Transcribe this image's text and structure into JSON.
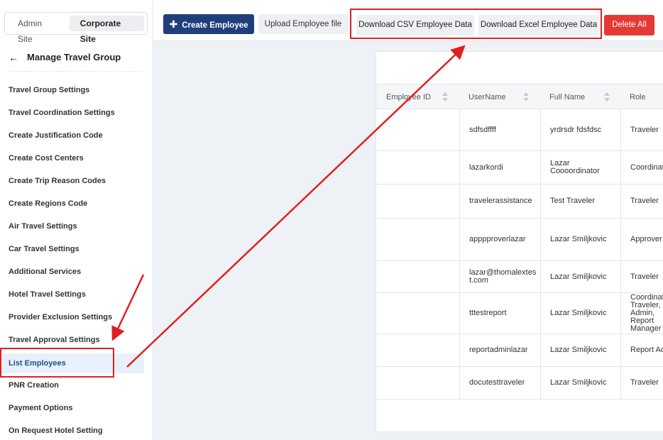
{
  "site_switch": {
    "admin": "Admin Site",
    "corporate": "Corporate Site"
  },
  "sidebar": {
    "title": "Manage Travel Group",
    "items": [
      "Travel Group Settings",
      "Travel Coordination Settings",
      "Create Justification Code",
      "Create Cost Centers",
      "Create Trip Reason Codes",
      "Create Regions Code",
      "Air Travel Settings",
      "Car Travel Settings",
      "Additional Services",
      "Hotel Travel Settings",
      "Provider Exclusion Settings",
      "Travel Approval Settings",
      "List Employees",
      "PNR Creation",
      "Payment Options",
      "On Request Hotel Setting"
    ],
    "active_index": 12
  },
  "toolbar": {
    "create": "Create Employee",
    "upload": "Upload Employee file",
    "download_csv": "Download CSV Employee Data",
    "download_excel": "Download Excel Employee Data",
    "delete_all": "Delete All"
  },
  "table": {
    "headers": [
      "Employee ID",
      "UserName",
      "Full Name",
      "Role"
    ],
    "rows": [
      {
        "id": "",
        "username": "sdfsdffff",
        "fullname": "yrdrsdr fdsfdsc",
        "role": "Traveler"
      },
      {
        "id": "",
        "username": "lazarkordi",
        "fullname": "Lazar Coooordinator",
        "role": "Coordinator"
      },
      {
        "id": "",
        "username": "travelerassistance",
        "fullname": "Test Traveler",
        "role": "Traveler"
      },
      {
        "id": "",
        "username": "apppproverlazar",
        "fullname": "Lazar Smiljkovic",
        "role": "Approver"
      },
      {
        "id": "",
        "username": "lazar@thomalextest.com",
        "fullname": "Lazar Smiljkovic",
        "role": "Traveler"
      },
      {
        "id": "",
        "username": "tttestreport",
        "fullname": "Lazar Smiljkovic",
        "role": "Coordinator, Traveler, Admin, Report Manager"
      },
      {
        "id": "",
        "username": "reportadminlazar",
        "fullname": "Lazar Smiljkovic",
        "role": "Report Admin"
      },
      {
        "id": "",
        "username": "docutesttraveler",
        "fullname": "Lazar Smiljkovic",
        "role": "Traveler"
      }
    ]
  },
  "colors": {
    "primary": "#1e3f7a",
    "danger": "#e53935",
    "annotation": "#e02020"
  }
}
